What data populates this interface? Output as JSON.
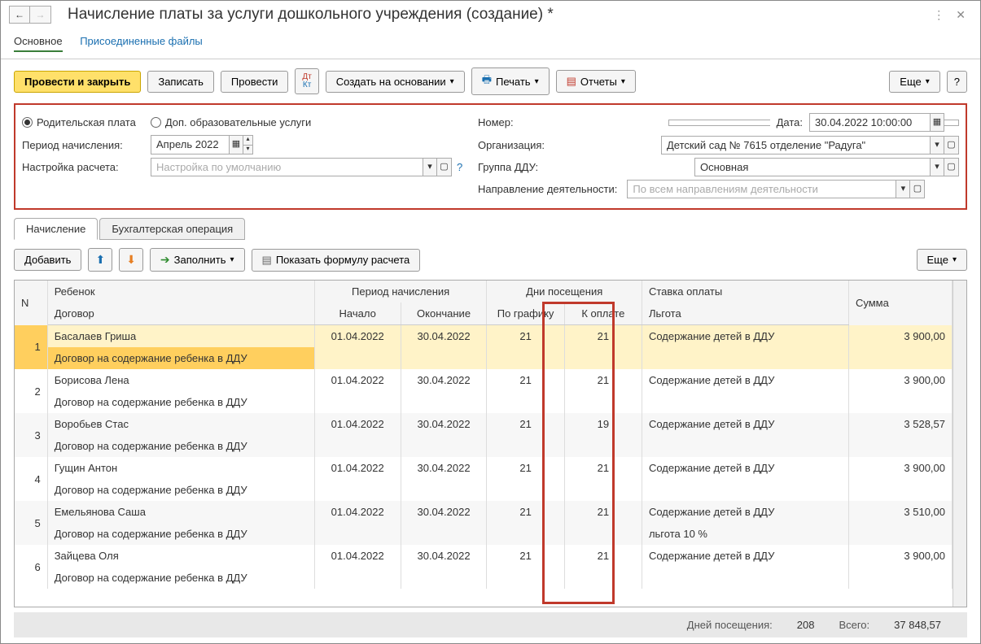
{
  "title": "Начисление платы за услуги дошкольного учреждения (создание) *",
  "type_tabs": {
    "main": "Основное",
    "attached": "Присоединенные файлы"
  },
  "toolbar": {
    "post_close": "Провести и закрыть",
    "save": "Записать",
    "post": "Провести",
    "create_based": "Создать на основании",
    "print": "Печать",
    "reports": "Отчеты",
    "more": "Еще"
  },
  "fields": {
    "radio_parent": "Родительская плата",
    "radio_extra": "Доп. образовательные услуги",
    "period_label": "Период начисления:",
    "period_value": "Апрель 2022",
    "calc_label": "Настройка расчета:",
    "calc_placeholder": "Настройка по умолчанию",
    "number_label": "Номер:",
    "number_value": "",
    "date_label": "Дата:",
    "date_value": "30.04.2022 10:00:00",
    "org_label": "Организация:",
    "org_value": "Детский сад № 7615 отделение \"Радуга\"",
    "group_label": "Группа ДДУ:",
    "group_value": "Основная",
    "direction_label": "Направление деятельности:",
    "direction_placeholder": "По всем направлениям деятельности"
  },
  "tabs": {
    "accrual": "Начисление",
    "bookkeeping": "Бухгалтерская операция"
  },
  "grid_toolbar": {
    "add": "Добавить",
    "fill": "Заполнить",
    "formula": "Показать формулу расчета",
    "more": "Еще"
  },
  "headers": {
    "n": "N",
    "child": "Ребенок",
    "contract": "Договор",
    "period": "Период начисления",
    "start": "Начало",
    "end": "Окончание",
    "visits": "Дни посещения",
    "scheduled": "По графику",
    "payable": "К оплате",
    "rate": "Ставка оплаты",
    "benefit": "Льгота",
    "sum": "Сумма"
  },
  "rows": [
    {
      "n": "1",
      "child": "Басалаев Гриша",
      "contract": "Договор на содержание ребенка в ДДУ",
      "start": "01.04.2022",
      "end": "30.04.2022",
      "scheduled": "21",
      "payable": "21",
      "rate": "Содержание детей в ДДУ",
      "benefit": "",
      "sum": "3 900,00"
    },
    {
      "n": "2",
      "child": "Борисова Лена",
      "contract": "Договор на содержание ребенка в ДДУ",
      "start": "01.04.2022",
      "end": "30.04.2022",
      "scheduled": "21",
      "payable": "21",
      "rate": "Содержание детей в ДДУ",
      "benefit": "",
      "sum": "3 900,00"
    },
    {
      "n": "3",
      "child": "Воробьев Стас",
      "contract": "Договор на содержание ребенка в ДДУ",
      "start": "01.04.2022",
      "end": "30.04.2022",
      "scheduled": "21",
      "payable": "19",
      "rate": "Содержание детей в ДДУ",
      "benefit": "",
      "sum": "3 528,57"
    },
    {
      "n": "4",
      "child": "Гущин Антон",
      "contract": "Договор на содержание ребенка в ДДУ",
      "start": "01.04.2022",
      "end": "30.04.2022",
      "scheduled": "21",
      "payable": "21",
      "rate": "Содержание детей в ДДУ",
      "benefit": "",
      "sum": "3 900,00"
    },
    {
      "n": "5",
      "child": "Емельянова Саша",
      "contract": "Договор на содержание ребенка в ДДУ",
      "start": "01.04.2022",
      "end": "30.04.2022",
      "scheduled": "21",
      "payable": "21",
      "rate": "Содержание детей в ДДУ",
      "benefit": "льгота 10 %",
      "sum": "3 510,00"
    },
    {
      "n": "6",
      "child": "Зайцева Оля",
      "contract": "Договор на содержание ребенка в ДДУ",
      "start": "01.04.2022",
      "end": "30.04.2022",
      "scheduled": "21",
      "payable": "21",
      "rate": "Содержание детей в ДДУ",
      "benefit": "",
      "sum": "3 900,00"
    }
  ],
  "footer": {
    "days_label": "Дней посещения:",
    "days": "208",
    "total_label": "Всего:",
    "total": "37 848,57"
  }
}
